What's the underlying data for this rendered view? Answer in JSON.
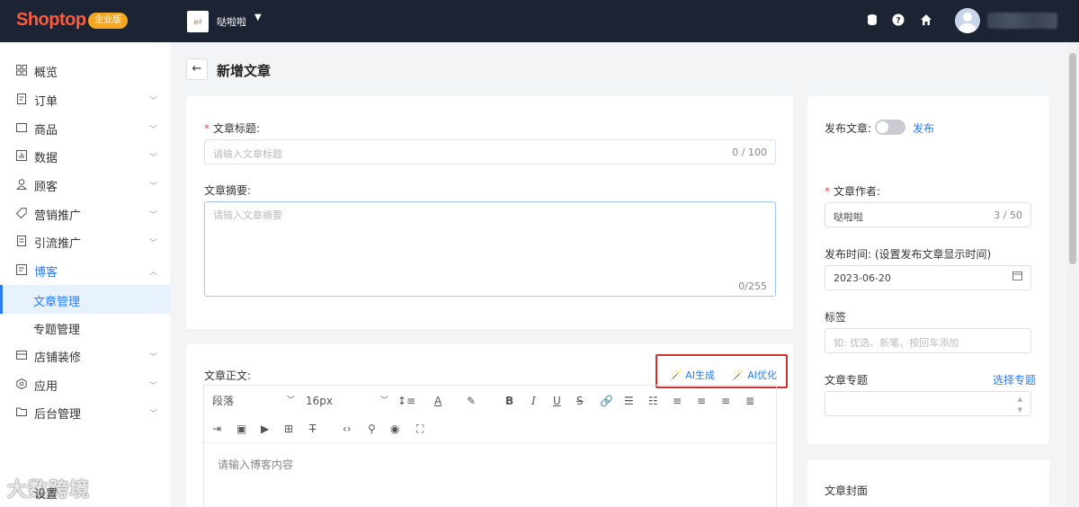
{
  "topbar": {
    "logo": "Shoptop",
    "edition": "企业版",
    "shop_thumb_text": "gol",
    "shop_name": "哒啦啦",
    "icons": [
      "database-icon",
      "help-icon",
      "home-icon"
    ]
  },
  "sidebar": {
    "items": [
      {
        "label": "概览",
        "icon": "dashboard-icon"
      },
      {
        "label": "订单",
        "icon": "order-icon"
      },
      {
        "label": "商品",
        "icon": "product-icon"
      },
      {
        "label": "数据",
        "icon": "chart-icon"
      },
      {
        "label": "顾客",
        "icon": "user-icon"
      },
      {
        "label": "营销推广",
        "icon": "tag-icon"
      },
      {
        "label": "引流推广",
        "icon": "doc-icon"
      },
      {
        "label": "博客",
        "icon": "blog-icon"
      },
      {
        "label": "店铺装修",
        "icon": "store-icon"
      },
      {
        "label": "应用",
        "icon": "app-icon"
      },
      {
        "label": "后台管理",
        "icon": "folder-icon"
      }
    ],
    "sub_items": [
      "文章管理",
      "专题管理"
    ],
    "settings_label": "设置",
    "watermark": "大数跨境"
  },
  "page": {
    "title": "新增文章"
  },
  "form": {
    "title_label": "文章标题:",
    "title_placeholder": "请输入文章标题",
    "title_count": "0 / 100",
    "summary_label": "文章摘要:",
    "summary_placeholder": "请输入文章摘要",
    "summary_count": "0/255",
    "body_label": "文章正文:",
    "ai_generate": "AI生成",
    "ai_optimize": "AI优化",
    "paragraph_select": "段落",
    "font_size_select": "16px",
    "body_placeholder": "请输入博客内容"
  },
  "side": {
    "publish_label": "发布文章:",
    "publish_text": "发布",
    "author_label": "文章作者:",
    "author_value": "哒啦啦",
    "author_count": "3 / 50",
    "time_label": "发布时间:  (设置发布文章显示时间)",
    "time_value": "2023-06-20",
    "tags_label": "标签",
    "tags_placeholder": "如: 优选、新笔、按回车添加",
    "topic_label": "文章专题",
    "topic_link": "选择专题",
    "cover_label": "文章封面"
  },
  "colors": {
    "topbar": "#1c2434",
    "accent": "#2d7cf6",
    "highlight_box": "#d32f2f",
    "edition_badge": "#f5a623"
  }
}
